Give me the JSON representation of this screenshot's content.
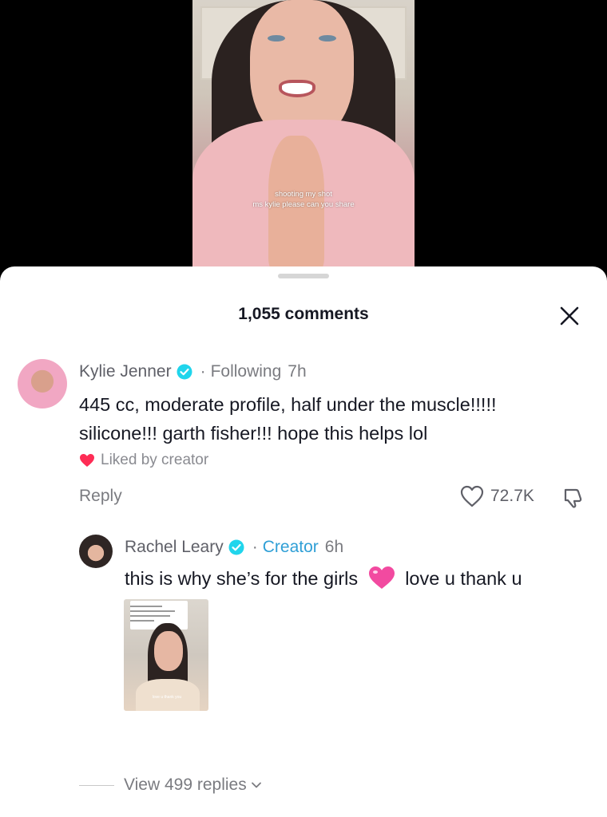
{
  "video": {
    "caption_line1": "shooting my shot",
    "caption_line2": "ms kylie please can you share"
  },
  "sheet": {
    "title": "1,055 comments",
    "close_icon": "close-icon"
  },
  "comments": [
    {
      "author": "Kylie Jenner",
      "verified": true,
      "relationship": "Following",
      "time": "7h",
      "line1": "445 cc, moderate profile, half under the muscle!!!!!",
      "line2": "silicone!!! garth fisher!!! hope this helps lol",
      "liked_by": "Liked by creator",
      "reply_label": "Reply",
      "like_count": "72.7K"
    },
    {
      "author": "Rachel Leary",
      "verified": true,
      "relationship": "Creator",
      "time": "6h",
      "text_before": "this is why she’s for the girls",
      "emoji": "pink-heart",
      "text_after": "love u thank u",
      "thumb_caption": "love u thank you"
    }
  ],
  "replies": {
    "label": "View 499 replies"
  },
  "colors": {
    "verified": "#20d5ec",
    "creator": "#2f9fd6",
    "liked_heart": "#fe2c55",
    "emoji_heart": "#f24aa0"
  }
}
